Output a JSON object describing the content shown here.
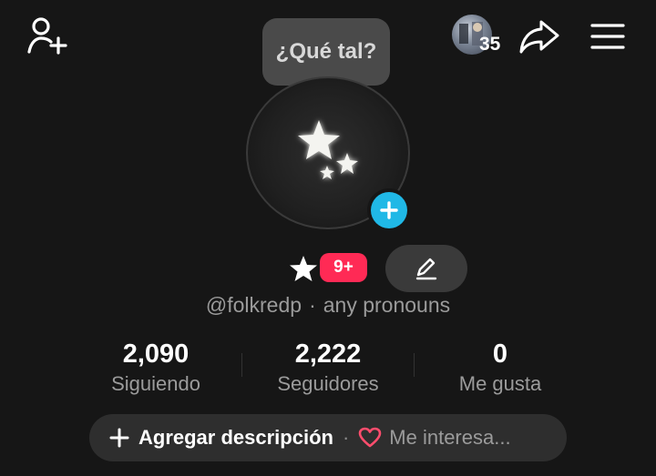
{
  "header": {
    "add_friend_icon": "person-plus-icon",
    "friends_count": "35",
    "share_icon": "share-arrow-icon",
    "menu_icon": "hamburger-menu-icon"
  },
  "status_bubble": {
    "text": "¿Qué tal?"
  },
  "profile": {
    "avatar_icon": "stars-avatar",
    "add_photo_icon": "plus-icon",
    "star_icon": "star-icon",
    "notification_badge": "9+",
    "edit_icon": "pencil-icon",
    "username": "@folkredp",
    "separator": "·",
    "pronouns": "any pronouns"
  },
  "stats": [
    {
      "value": "2,090",
      "label": "Siguiendo"
    },
    {
      "value": "2,222",
      "label": "Seguidores"
    },
    {
      "value": "0",
      "label": "Me gusta"
    }
  ],
  "description_bar": {
    "add_label": "Agregar descripción",
    "separator": "·",
    "interests_label": "Me interesa..."
  },
  "colors": {
    "background": "#161616",
    "accent_blue": "#20b8e6",
    "badge_red": "#ff2a55",
    "heart_pink": "#ff4d6d"
  }
}
